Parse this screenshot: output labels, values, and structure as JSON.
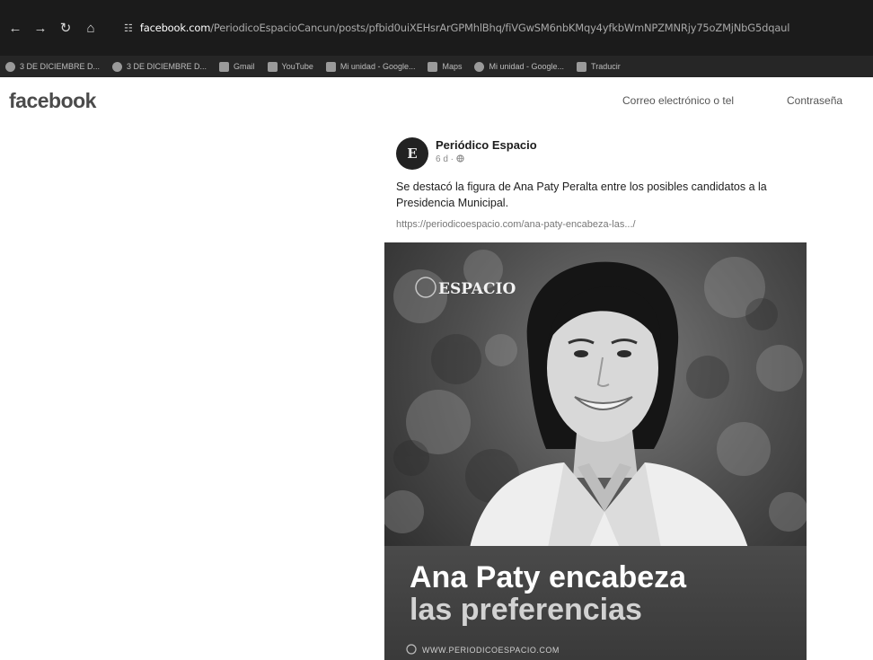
{
  "browser": {
    "nav_icons": [
      "back-arrow-icon",
      "forward-arrow-icon",
      "reload-icon",
      "home-icon"
    ],
    "url_host": "facebook.com",
    "url_path": "/PeriodicoEspacioCancun/posts/pfbid0uiXEHsrArGPMhlBhq/fiVGwSM6nbKMqy4yfkbWmNPZMNRjy75oZMjNbG5dqaul",
    "bookmarks": [
      {
        "label": "3 DE DICIEMBRE D...",
        "icon": "globe-icon"
      },
      {
        "label": "3 DE DICIEMBRE D...",
        "icon": "globe-icon"
      },
      {
        "label": "Gmail",
        "icon": "gmail-icon"
      },
      {
        "label": "YouTube",
        "icon": "youtube-icon"
      },
      {
        "label": "Mi unidad - Google...",
        "icon": "drive-icon"
      },
      {
        "label": "Maps",
        "icon": "maps-icon"
      },
      {
        "label": "Mi unidad - Google...",
        "icon": "google-icon"
      },
      {
        "label": "Traducir",
        "icon": "translate-icon"
      }
    ]
  },
  "facebook": {
    "logo": "facebook",
    "login": {
      "email_placeholder": "Correo electrónico o tel",
      "password_placeholder": "Contraseña"
    }
  },
  "post": {
    "page_name": "Periódico Espacio",
    "avatar_letter": "E",
    "time": "6 d ·",
    "text": "Se destacó la figura de Ana Paty Peralta entre los posibles candidatos a la Presidencia Municipal.",
    "link": "https://periodicoespacio.com/ana-paty-encabeza-las.../",
    "image": {
      "brand": "ESPACIO",
      "headline_line1": "Ana Paty encabeza",
      "headline_line2": "las preferencias",
      "website": "WWW.PERIODICOESPACIO.COM"
    }
  }
}
